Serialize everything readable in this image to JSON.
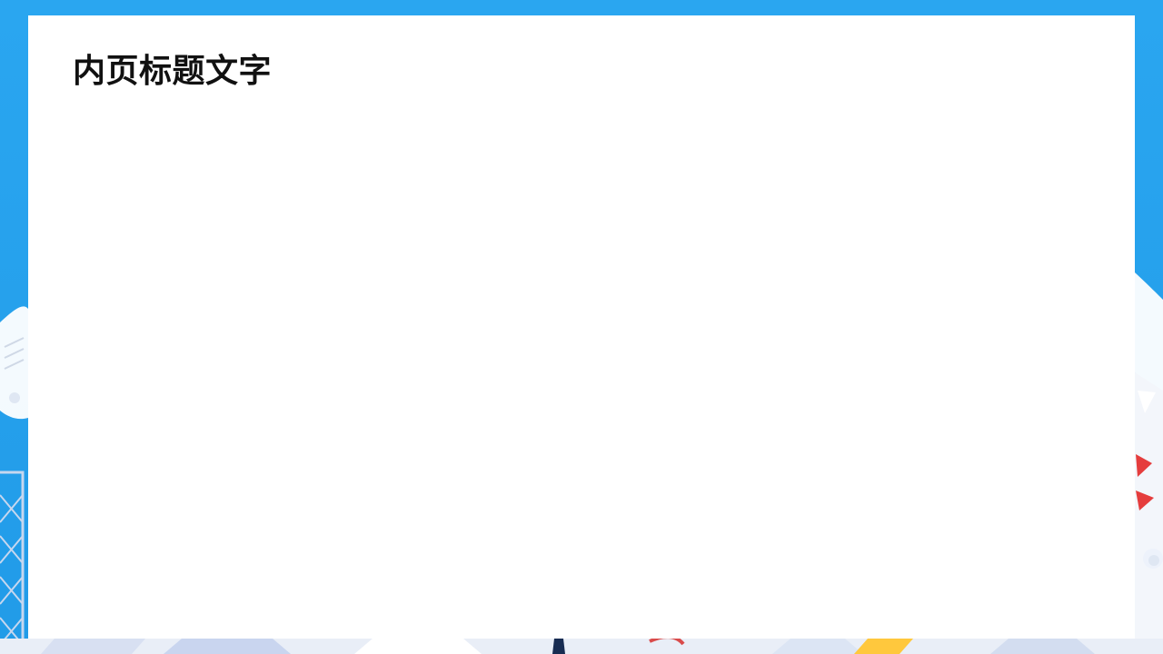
{
  "slide": {
    "title": "内页标题文字"
  },
  "colors": {
    "background": "#27a3ef",
    "card": "#ffffff",
    "title": "#111111"
  }
}
